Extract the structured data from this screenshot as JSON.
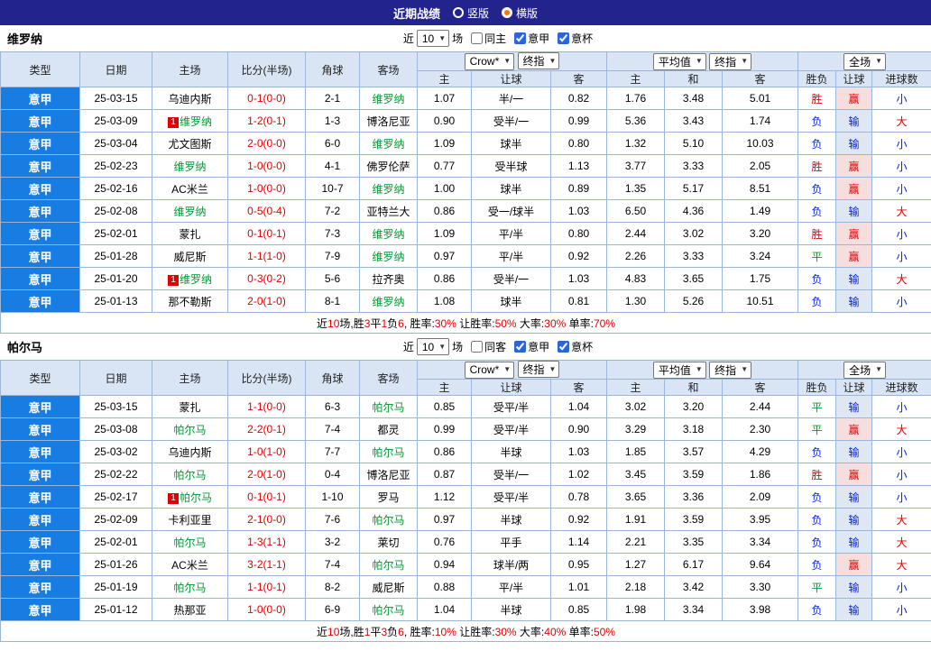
{
  "titlebar": {
    "title": "近期战绩",
    "options": [
      {
        "label": "竖版",
        "selected": false
      },
      {
        "label": "横版",
        "selected": true
      }
    ]
  },
  "columns": {
    "type": "类型",
    "date": "日期",
    "home": "主场",
    "score": "比分(半场)",
    "corner": "角球",
    "away": "客场",
    "odds_home": "主",
    "odds_handicap": "让球",
    "odds_away": "客",
    "avg_home": "主",
    "avg_draw": "和",
    "avg_away": "客",
    "result": "胜负",
    "handicap_result": "让球",
    "goals": "进球数"
  },
  "dropdowns": {
    "bookmaker": "Crow*",
    "final_odds": "终指",
    "average": "平均值",
    "scope": "全场"
  },
  "colors": {
    "accent_blue": "#177de2",
    "header_navy": "#23238e",
    "win_red": "#e00000",
    "lose_blue": "#0022dd",
    "draw_green": "#009933",
    "focus_green": "#009900"
  },
  "sections": [
    {
      "team": "维罗纳",
      "filter": {
        "prefix": "近",
        "count": "10",
        "suffix": "场",
        "checkboxes": [
          {
            "label": "同主",
            "checked": false
          },
          {
            "label": "意甲",
            "checked": true
          },
          {
            "label": "意杯",
            "checked": true
          }
        ]
      },
      "rows": [
        {
          "league": "意甲",
          "date": "25-03-15",
          "home": "乌迪内斯",
          "home_focus": false,
          "home_badge": null,
          "score": "0-1(0-0)",
          "corner": "2-1",
          "away": "维罗纳",
          "away_focus": true,
          "away_badge": null,
          "odds": [
            "1.07",
            "半/一",
            "0.82"
          ],
          "avg": [
            "1.76",
            "3.48",
            "5.01"
          ],
          "result": "胜",
          "handicap_result": "赢",
          "goals": "小"
        },
        {
          "league": "意甲",
          "date": "25-03-09",
          "home": "维罗纳",
          "home_focus": true,
          "home_badge": "1",
          "score": "1-2(0-1)",
          "corner": "1-3",
          "away": "博洛尼亚",
          "away_focus": false,
          "away_badge": null,
          "odds": [
            "0.90",
            "受半/一",
            "0.99"
          ],
          "avg": [
            "5.36",
            "3.43",
            "1.74"
          ],
          "result": "负",
          "handicap_result": "输",
          "goals": "大"
        },
        {
          "league": "意甲",
          "date": "25-03-04",
          "home": "尤文图斯",
          "home_focus": false,
          "home_badge": null,
          "score": "2-0(0-0)",
          "corner": "6-0",
          "away": "维罗纳",
          "away_focus": true,
          "away_badge": null,
          "odds": [
            "1.09",
            "球半",
            "0.80"
          ],
          "avg": [
            "1.32",
            "5.10",
            "10.03"
          ],
          "result": "负",
          "handicap_result": "输",
          "goals": "小"
        },
        {
          "league": "意甲",
          "date": "25-02-23",
          "home": "维罗纳",
          "home_focus": true,
          "home_badge": null,
          "score": "1-0(0-0)",
          "corner": "4-1",
          "away": "佛罗伦萨",
          "away_focus": false,
          "away_badge": null,
          "odds": [
            "0.77",
            "受半球",
            "1.13"
          ],
          "avg": [
            "3.77",
            "3.33",
            "2.05"
          ],
          "result": "胜",
          "handicap_result": "赢",
          "goals": "小"
        },
        {
          "league": "意甲",
          "date": "25-02-16",
          "home": "AC米兰",
          "home_focus": false,
          "home_badge": null,
          "score": "1-0(0-0)",
          "corner": "10-7",
          "away": "维罗纳",
          "away_focus": true,
          "away_badge": null,
          "odds": [
            "1.00",
            "球半",
            "0.89"
          ],
          "avg": [
            "1.35",
            "5.17",
            "8.51"
          ],
          "result": "负",
          "handicap_result": "赢",
          "goals": "小"
        },
        {
          "league": "意甲",
          "date": "25-02-08",
          "home": "维罗纳",
          "home_focus": true,
          "home_badge": null,
          "score": "0-5(0-4)",
          "corner": "7-2",
          "away": "亚特兰大",
          "away_focus": false,
          "away_badge": null,
          "odds": [
            "0.86",
            "受一/球半",
            "1.03"
          ],
          "avg": [
            "6.50",
            "4.36",
            "1.49"
          ],
          "result": "负",
          "handicap_result": "输",
          "goals": "大"
        },
        {
          "league": "意甲",
          "date": "25-02-01",
          "home": "蒙扎",
          "home_focus": false,
          "home_badge": null,
          "score": "0-1(0-1)",
          "corner": "7-3",
          "away": "维罗纳",
          "away_focus": true,
          "away_badge": null,
          "odds": [
            "1.09",
            "平/半",
            "0.80"
          ],
          "avg": [
            "2.44",
            "3.02",
            "3.20"
          ],
          "result": "胜",
          "handicap_result": "赢",
          "goals": "小"
        },
        {
          "league": "意甲",
          "date": "25-01-28",
          "home": "威尼斯",
          "home_focus": false,
          "home_badge": null,
          "score": "1-1(1-0)",
          "corner": "7-9",
          "away": "维罗纳",
          "away_focus": true,
          "away_badge": null,
          "odds": [
            "0.97",
            "平/半",
            "0.92"
          ],
          "avg": [
            "2.26",
            "3.33",
            "3.24"
          ],
          "result": "平",
          "handicap_result": "赢",
          "goals": "小"
        },
        {
          "league": "意甲",
          "date": "25-01-20",
          "home": "维罗纳",
          "home_focus": true,
          "home_badge": "1",
          "score": "0-3(0-2)",
          "corner": "5-6",
          "away": "拉齐奥",
          "away_focus": false,
          "away_badge": null,
          "odds": [
            "0.86",
            "受半/一",
            "1.03"
          ],
          "avg": [
            "4.83",
            "3.65",
            "1.75"
          ],
          "result": "负",
          "handicap_result": "输",
          "goals": "大"
        },
        {
          "league": "意甲",
          "date": "25-01-13",
          "home": "那不勒斯",
          "home_focus": false,
          "home_badge": null,
          "score": "2-0(1-0)",
          "corner": "8-1",
          "away": "维罗纳",
          "away_focus": true,
          "away_badge": null,
          "odds": [
            "1.08",
            "球半",
            "0.81"
          ],
          "avg": [
            "1.30",
            "5.26",
            "10.51"
          ],
          "result": "负",
          "handicap_result": "输",
          "goals": "小"
        }
      ],
      "summary": [
        {
          "t": "近"
        },
        {
          "t": "10",
          "r": 1
        },
        {
          "t": "场,胜"
        },
        {
          "t": "3",
          "r": 1
        },
        {
          "t": "平"
        },
        {
          "t": "1",
          "r": 1
        },
        {
          "t": "负"
        },
        {
          "t": "6",
          "r": 1
        },
        {
          "t": ", 胜率:"
        },
        {
          "t": "30%",
          "r": 1
        },
        {
          "t": " 让胜率:"
        },
        {
          "t": "50%",
          "r": 1
        },
        {
          "t": " 大率:"
        },
        {
          "t": "30%",
          "r": 1
        },
        {
          "t": " 单率:"
        },
        {
          "t": "70%",
          "r": 1
        }
      ]
    },
    {
      "team": "帕尔马",
      "filter": {
        "prefix": "近",
        "count": "10",
        "suffix": "场",
        "checkboxes": [
          {
            "label": "同客",
            "checked": false
          },
          {
            "label": "意甲",
            "checked": true
          },
          {
            "label": "意杯",
            "checked": true
          }
        ]
      },
      "rows": [
        {
          "league": "意甲",
          "date": "25-03-15",
          "home": "蒙扎",
          "home_focus": false,
          "home_badge": null,
          "score": "1-1(0-0)",
          "corner": "6-3",
          "away": "帕尔马",
          "away_focus": true,
          "away_badge": null,
          "odds": [
            "0.85",
            "受平/半",
            "1.04"
          ],
          "avg": [
            "3.02",
            "3.20",
            "2.44"
          ],
          "result": "平",
          "handicap_result": "输",
          "goals": "小"
        },
        {
          "league": "意甲",
          "date": "25-03-08",
          "home": "帕尔马",
          "home_focus": true,
          "home_badge": null,
          "score": "2-2(0-1)",
          "corner": "7-4",
          "away": "都灵",
          "away_focus": false,
          "away_badge": null,
          "odds": [
            "0.99",
            "受平/半",
            "0.90"
          ],
          "avg": [
            "3.29",
            "3.18",
            "2.30"
          ],
          "result": "平",
          "handicap_result": "赢",
          "goals": "大"
        },
        {
          "league": "意甲",
          "date": "25-03-02",
          "home": "乌迪内斯",
          "home_focus": false,
          "home_badge": null,
          "score": "1-0(1-0)",
          "corner": "7-7",
          "away": "帕尔马",
          "away_focus": true,
          "away_badge": null,
          "odds": [
            "0.86",
            "半球",
            "1.03"
          ],
          "avg": [
            "1.85",
            "3.57",
            "4.29"
          ],
          "result": "负",
          "handicap_result": "输",
          "goals": "小"
        },
        {
          "league": "意甲",
          "date": "25-02-22",
          "home": "帕尔马",
          "home_focus": true,
          "home_badge": null,
          "score": "2-0(1-0)",
          "corner": "0-4",
          "away": "博洛尼亚",
          "away_focus": false,
          "away_badge": null,
          "odds": [
            "0.87",
            "受半/一",
            "1.02"
          ],
          "avg": [
            "3.45",
            "3.59",
            "1.86"
          ],
          "result": "胜",
          "handicap_result": "赢",
          "goals": "小"
        },
        {
          "league": "意甲",
          "date": "25-02-17",
          "home": "帕尔马",
          "home_focus": true,
          "home_badge": "1",
          "score": "0-1(0-1)",
          "corner": "1-10",
          "away": "罗马",
          "away_focus": false,
          "away_badge": null,
          "odds": [
            "1.12",
            "受平/半",
            "0.78"
          ],
          "avg": [
            "3.65",
            "3.36",
            "2.09"
          ],
          "result": "负",
          "handicap_result": "输",
          "goals": "小"
        },
        {
          "league": "意甲",
          "date": "25-02-09",
          "home": "卡利亚里",
          "home_focus": false,
          "home_badge": null,
          "score": "2-1(0-0)",
          "corner": "7-6",
          "away": "帕尔马",
          "away_focus": true,
          "away_badge": null,
          "odds": [
            "0.97",
            "半球",
            "0.92"
          ],
          "avg": [
            "1.91",
            "3.59",
            "3.95"
          ],
          "result": "负",
          "handicap_result": "输",
          "goals": "大"
        },
        {
          "league": "意甲",
          "date": "25-02-01",
          "home": "帕尔马",
          "home_focus": true,
          "home_badge": null,
          "score": "1-3(1-1)",
          "corner": "3-2",
          "away": "莱切",
          "away_focus": false,
          "away_badge": null,
          "odds": [
            "0.76",
            "平手",
            "1.14"
          ],
          "avg": [
            "2.21",
            "3.35",
            "3.34"
          ],
          "result": "负",
          "handicap_result": "输",
          "goals": "大"
        },
        {
          "league": "意甲",
          "date": "25-01-26",
          "home": "AC米兰",
          "home_focus": false,
          "home_badge": null,
          "score": "3-2(1-1)",
          "corner": "7-4",
          "away": "帕尔马",
          "away_focus": true,
          "away_badge": null,
          "odds": [
            "0.94",
            "球半/两",
            "0.95"
          ],
          "avg": [
            "1.27",
            "6.17",
            "9.64"
          ],
          "result": "负",
          "handicap_result": "赢",
          "goals": "大"
        },
        {
          "league": "意甲",
          "date": "25-01-19",
          "home": "帕尔马",
          "home_focus": true,
          "home_badge": null,
          "score": "1-1(0-1)",
          "corner": "8-2",
          "away": "威尼斯",
          "away_focus": false,
          "away_badge": null,
          "odds": [
            "0.88",
            "平/半",
            "1.01"
          ],
          "avg": [
            "2.18",
            "3.42",
            "3.30"
          ],
          "result": "平",
          "handicap_result": "输",
          "goals": "小"
        },
        {
          "league": "意甲",
          "date": "25-01-12",
          "home": "热那亚",
          "home_focus": false,
          "home_badge": null,
          "score": "1-0(0-0)",
          "corner": "6-9",
          "away": "帕尔马",
          "away_focus": true,
          "away_badge": null,
          "odds": [
            "1.04",
            "半球",
            "0.85"
          ],
          "avg": [
            "1.98",
            "3.34",
            "3.98"
          ],
          "result": "负",
          "handicap_result": "输",
          "goals": "小"
        }
      ],
      "summary": [
        {
          "t": "近"
        },
        {
          "t": "10",
          "r": 1
        },
        {
          "t": "场,胜"
        },
        {
          "t": "1",
          "r": 1
        },
        {
          "t": "平"
        },
        {
          "t": "3",
          "r": 1
        },
        {
          "t": "负"
        },
        {
          "t": "6",
          "r": 1
        },
        {
          "t": ", 胜率:"
        },
        {
          "t": "10%",
          "r": 1
        },
        {
          "t": " 让胜率:"
        },
        {
          "t": "30%",
          "r": 1
        },
        {
          "t": " 大率:"
        },
        {
          "t": "40%",
          "r": 1
        },
        {
          "t": " 单率:"
        },
        {
          "t": "50%",
          "r": 1
        }
      ]
    }
  ]
}
